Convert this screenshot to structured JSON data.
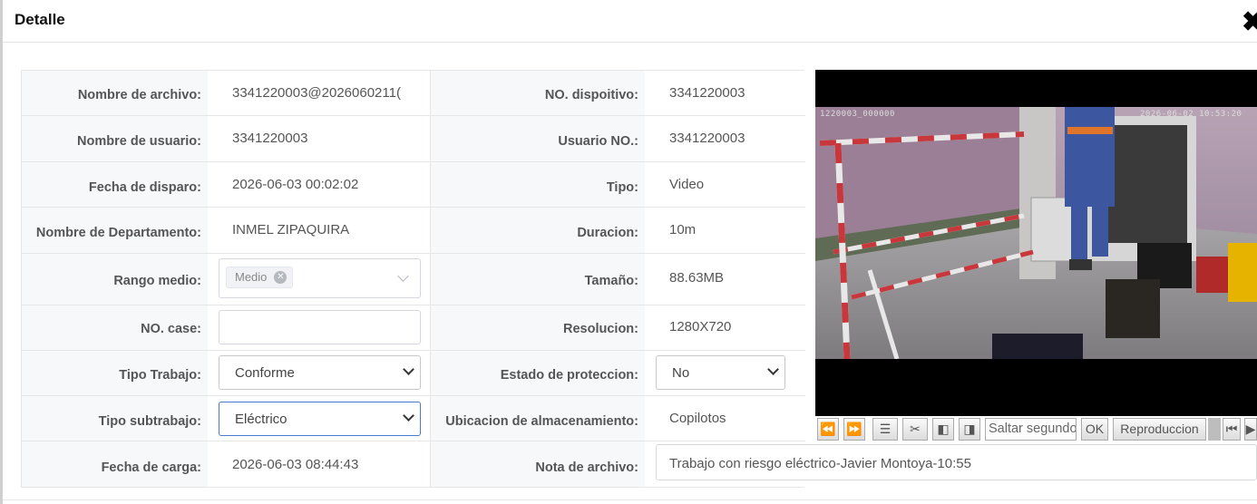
{
  "dialog": {
    "title": "Detalle",
    "close_icon": "close-icon"
  },
  "form": {
    "file_name": {
      "label": "Nombre de archivo:",
      "value": "3341220003@2026060211("
    },
    "device_no": {
      "label": "NO. dispoitivo:",
      "value": "3341220003"
    },
    "user_name": {
      "label": "Nombre de usuario:",
      "value": "3341220003"
    },
    "user_no": {
      "label": "Usuario NO.:",
      "value": "3341220003"
    },
    "trigger_date": {
      "label": "Fecha de disparo:",
      "value": "2026-06-03 00:02:02"
    },
    "type": {
      "label": "Tipo:",
      "value": "Video"
    },
    "department": {
      "label": "Nombre de Departamento:",
      "value": "INMEL ZIPAQUIRA"
    },
    "duration": {
      "label": "Duracion:",
      "value": "10m"
    },
    "range": {
      "label": "Rango medio:",
      "tag": "Medio"
    },
    "size": {
      "label": "Tamaño:",
      "value": "88.63MB"
    },
    "case_no": {
      "label": "NO. case:",
      "value": ""
    },
    "resolution": {
      "label": "Resolucion:",
      "value": "1280X720"
    },
    "work_type": {
      "label": "Tipo Trabajo:",
      "value": "Conforme"
    },
    "protection": {
      "label": "Estado de proteccion:",
      "value": "No"
    },
    "sub_work": {
      "label": "Tipo subtrabajo:",
      "value": "Eléctrico"
    },
    "storage": {
      "label": "Ubicacion de almacenamiento:",
      "value": "Copilotos"
    },
    "upload_date": {
      "label": "Fecha de carga:",
      "value": "2026-06-03 08:44:43"
    },
    "note": {
      "label": "Nota de archivo:",
      "value": "Trabajo con riesgo eléctrico-Javier Montoya-10:55"
    }
  },
  "player": {
    "osd_left": "1220003_000000",
    "osd_right": "2026-06-02 10:53:20",
    "seek_placeholder": "Saltar segundo",
    "ok_label": "OK",
    "playback_label": "Reproduccion"
  }
}
